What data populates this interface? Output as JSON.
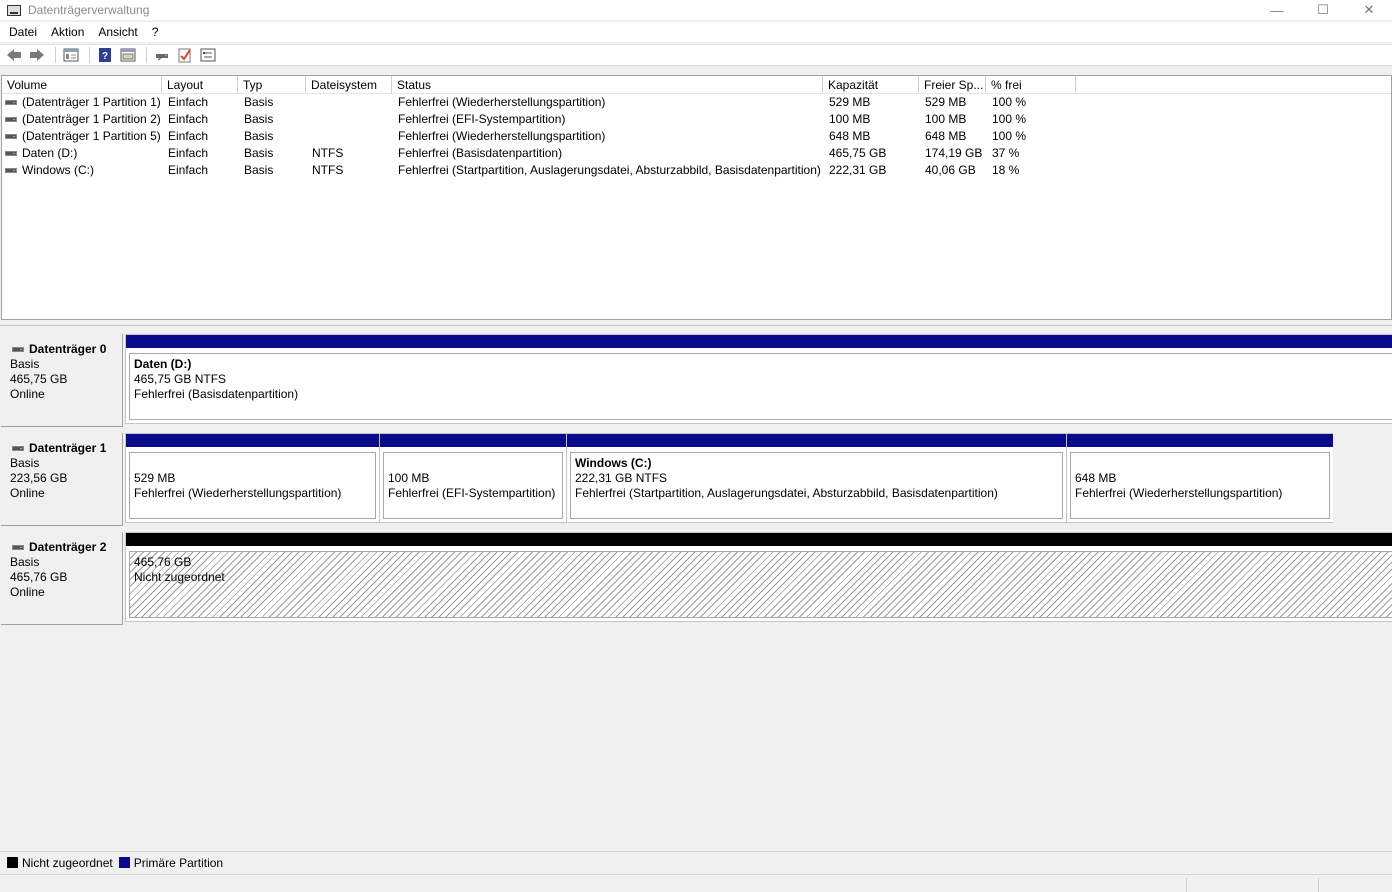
{
  "window": {
    "title": "Datenträgerverwaltung",
    "min_glyph": "—",
    "max_glyph": "☐",
    "close_glyph": "✕"
  },
  "menu": [
    "Datei",
    "Aktion",
    "Ansicht",
    "?"
  ],
  "toolbar": [
    "back-icon",
    "forward-icon",
    "properties-icon",
    "help-icon",
    "view-icon",
    "connect-icon",
    "check-icon",
    "settings-icon"
  ],
  "volume_list": {
    "columns": [
      "Volume",
      "Layout",
      "Typ",
      "Dateisystem",
      "Status",
      "Kapazität",
      "Freier Sp...",
      "% frei"
    ],
    "rows": [
      [
        "(Datenträger 1 Partition 1)",
        "Einfach",
        "Basis",
        "",
        "Fehlerfrei (Wiederherstellungspartition)",
        "529 MB",
        "529 MB",
        "100 %"
      ],
      [
        "(Datenträger 1 Partition 2)",
        "Einfach",
        "Basis",
        "",
        "Fehlerfrei (EFI-Systempartition)",
        "100 MB",
        "100 MB",
        "100 %"
      ],
      [
        "(Datenträger 1 Partition 5)",
        "Einfach",
        "Basis",
        "",
        "Fehlerfrei (Wiederherstellungspartition)",
        "648 MB",
        "648 MB",
        "100 %"
      ],
      [
        "Daten (D:)",
        "Einfach",
        "Basis",
        "NTFS",
        "Fehlerfrei (Basisdatenpartition)",
        "465,75 GB",
        "174,19 GB",
        "37 %"
      ],
      [
        "Windows (C:)",
        "Einfach",
        "Basis",
        "NTFS",
        "Fehlerfrei (Startpartition, Auslagerungsdatei, Absturzabbild, Basisdatenpartition)",
        "222,31 GB",
        "40,06 GB",
        "18 %"
      ]
    ]
  },
  "disks": [
    {
      "name": "Datenträger 0",
      "type": "Basis",
      "size": "465,75 GB",
      "state": "Online",
      "partitions": [
        {
          "name": "Daten  (D:)",
          "size": "465,75 GB NTFS",
          "status": "Fehlerfrei (Basisdatenpartition)"
        }
      ]
    },
    {
      "name": "Datenträger 1",
      "type": "Basis",
      "size": "223,56 GB",
      "state": "Online",
      "partitions": [
        {
          "name": "",
          "size": "529 MB",
          "status": "Fehlerfrei (Wiederherstellungspartition)"
        },
        {
          "name": "",
          "size": "100 MB",
          "status": "Fehlerfrei (EFI-Systempartition)"
        },
        {
          "name": "Windows  (C:)",
          "size": "222,31 GB NTFS",
          "status": "Fehlerfrei (Startpartition, Auslagerungsdatei, Absturzabbild, Basisdatenpartition)"
        },
        {
          "name": "",
          "size": "648 MB",
          "status": "Fehlerfrei (Wiederherstellungspartition)"
        }
      ]
    },
    {
      "name": "Datenträger 2",
      "type": "Basis",
      "size": "465,76 GB",
      "state": "Online",
      "partitions": [
        {
          "name": "",
          "size": "465,76 GB",
          "status": "Nicht zugeordnet"
        }
      ]
    }
  ],
  "legend": [
    {
      "label": "Nicht zugeordnet",
      "color": "#000000"
    },
    {
      "label": "Primäre Partition",
      "color": "#0a0a8c"
    }
  ]
}
